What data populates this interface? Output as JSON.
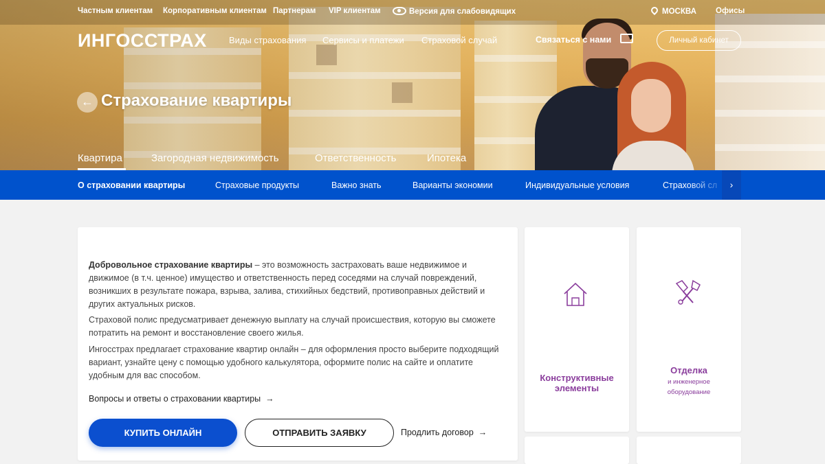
{
  "top_nav": {
    "private": "Частным клиентам",
    "corporate": "Корпоративным клиентам",
    "partners": "Партнерам",
    "vip": "VIP клиентам",
    "low_vision": "Версия для слабовидящих",
    "city": "МОСКВА",
    "offices": "Офисы"
  },
  "header": {
    "logo": "ИНГОССТРАХ",
    "nav": [
      "Виды страхования",
      "Сервисы и платежи",
      "Страховой случай"
    ],
    "contact": "Связаться с нами",
    "cabinet": "Личный кабинет"
  },
  "hero": {
    "title": "Страхование квартиры",
    "tabs": [
      "Квартира",
      "Загородная недвижимость",
      "Ответственность",
      "Ипотека"
    ],
    "active_tab": "Квартира"
  },
  "sub_nav": {
    "items": [
      "О страховании квартиры",
      "Страховые продукты",
      "Важно знать",
      "Варианты экономии",
      "Индивидуальные условия",
      "Страховой сл"
    ],
    "active": "О страховании квартиры",
    "arrow": "›"
  },
  "content": {
    "intro_bold": "Добровольное страхование квартиры",
    "intro_rest": " – это возможность застраховать ваше недвижимое и движимое (в т.ч. ценное) имущество и ответственность перед соседями на случай повреждений, возникших в результате пожара, взрыва, залива, стихийных бедствий, противоправных действий и других актуальных рисков.",
    "para2": "Страховой полис предусматривает денежную выплату на случай происшествия, которую вы сможете потратить на ремонт и восстановление своего жилья.",
    "para3": "Ингосстрах предлагает страхование квартир онлайн – для оформления просто выберите подходящий вариант, узнайте цену с помощью удобного калькулятора, оформите полис на сайте и оплатите удобным для вас способом.",
    "faq_link": "Вопросы и ответы о страховании квартиры",
    "buy_button": "КУПИТЬ ОНЛАЙН",
    "send_button": "ОТПРАВИТЬ ЗАЯВКУ",
    "extend_link": "Продлить договор"
  },
  "tiles": [
    {
      "title_line1": "Конструктивные",
      "title_line2": "элементы",
      "icon": "house-icon"
    },
    {
      "title_line1": "Отделка",
      "sub_line1": "и инженерное",
      "sub_line2": "оборудование",
      "icon": "tools-icon"
    }
  ],
  "colors": {
    "brand_blue": "#0052cc",
    "button_blue": "#0b4fcf",
    "accent_purple": "#8a3d9c"
  }
}
